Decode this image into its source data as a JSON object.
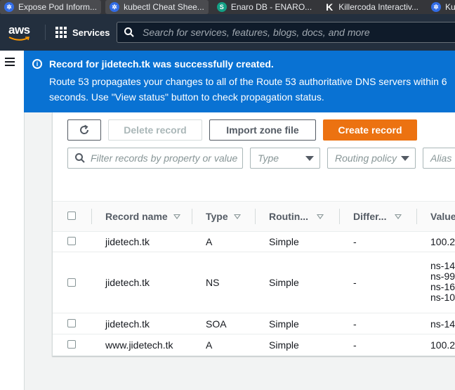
{
  "bookmarks": [
    {
      "label": "Expose Pod Inform...",
      "icon": "kubernetes-icon"
    },
    {
      "label": "kubectl Cheat Shee...",
      "icon": "kubernetes-icon"
    },
    {
      "label": "Enaro DB - ENARO...",
      "icon": "s-logo-icon",
      "icon_text": "S"
    },
    {
      "label": "Killercoda Interactiv...",
      "icon": "killercoda-icon",
      "icon_text": "K"
    },
    {
      "label": "Ku",
      "icon": "kubernetes-icon"
    }
  ],
  "nav": {
    "logo": "aws",
    "services": "Services",
    "search_placeholder": "Search for services, features, blogs, docs, and more"
  },
  "flash": {
    "title": "Record for jidetech.tk was successfully created.",
    "line1": "Route 53 propagates your changes to all of the Route 53 authoritative DNS servers within 6",
    "line2": "seconds. Use \"View status\" button to check propagation status."
  },
  "actions": {
    "delete": "Delete record",
    "import": "Import zone file",
    "create": "Create record"
  },
  "filters": {
    "search_placeholder": "Filter records by property or value",
    "type": "Type",
    "routing": "Routing policy",
    "alias": "Alias"
  },
  "columns": {
    "name": "Record name",
    "type": "Type",
    "routing": "Routin...",
    "diff": "Differ...",
    "value": "Value"
  },
  "rows": [
    {
      "name": "jidetech.tk",
      "type": "A",
      "routing": "Simple",
      "diff": "-",
      "value": [
        "100.2"
      ]
    },
    {
      "name": "jidetech.tk",
      "type": "NS",
      "routing": "Simple",
      "diff": "-",
      "value": [
        "ns-14",
        "ns-99",
        "ns-16",
        "ns-10"
      ]
    },
    {
      "name": "jidetech.tk",
      "type": "SOA",
      "routing": "Simple",
      "diff": "-",
      "value": [
        "ns-14"
      ]
    },
    {
      "name": "www.jidetech.tk",
      "type": "A",
      "routing": "Simple",
      "diff": "-",
      "value": [
        "100.2"
      ]
    }
  ],
  "colors": {
    "nav_bg": "#232f3e",
    "flash_bg": "#0972d3",
    "primary": "#ec7211"
  }
}
